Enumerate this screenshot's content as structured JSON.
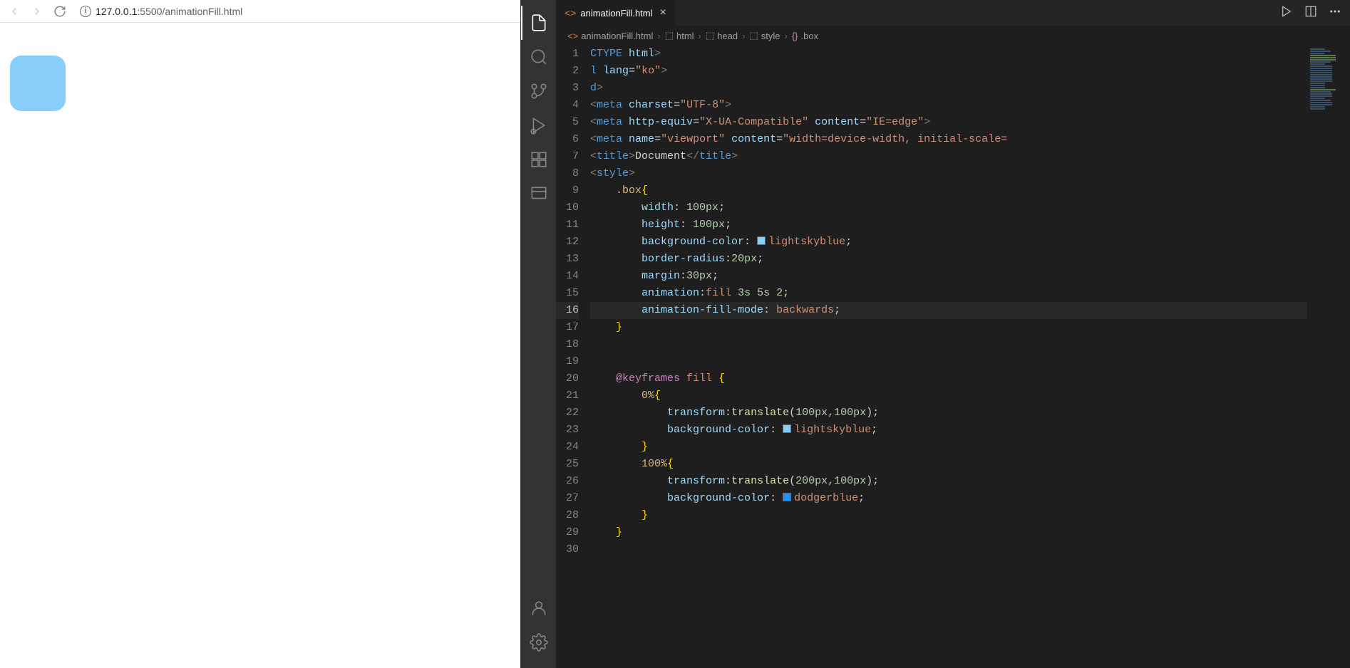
{
  "browser": {
    "url_host": "127.0.0.1",
    "url_port_path": ":5500/animationFill.html"
  },
  "tab": {
    "name": "animationFill.html",
    "close": "×"
  },
  "breadcrumbs": {
    "file": "animationFill.html",
    "html": "html",
    "head": "head",
    "style": "style",
    "box": ".box"
  },
  "sep": "›",
  "code": {
    "lines": [
      {
        "n": "1",
        "html": "<span class='tok-tag'>CTYPE</span> <span class='tok-attr'>html</span><span class='tok-punct'>&gt;</span>"
      },
      {
        "n": "2",
        "html": "<span class='tok-tag'>l</span> <span class='tok-attr'>lang</span>=<span class='tok-str'>\"ko\"</span><span class='tok-punct'>&gt;</span>"
      },
      {
        "n": "3",
        "html": "<span class='tok-tag'>d</span><span class='tok-punct'>&gt;</span>"
      },
      {
        "n": "4",
        "html": "<span class='tok-punct'>&lt;</span><span class='tok-tag'>meta</span> <span class='tok-attr'>charset</span>=<span class='tok-str'>\"UTF-8\"</span><span class='tok-punct'>&gt;</span>"
      },
      {
        "n": "5",
        "html": "<span class='tok-punct'>&lt;</span><span class='tok-tag'>meta</span> <span class='tok-attr'>http-equiv</span>=<span class='tok-str'>\"X-UA-Compatible\"</span> <span class='tok-attr'>content</span>=<span class='tok-str'>\"IE=edge\"</span><span class='tok-punct'>&gt;</span>"
      },
      {
        "n": "6",
        "html": "<span class='tok-punct'>&lt;</span><span class='tok-tag'>meta</span> <span class='tok-attr'>name</span>=<span class='tok-str'>\"viewport\"</span> <span class='tok-attr'>content</span>=<span class='tok-str'>\"width=device-width, initial-scale=</span>"
      },
      {
        "n": "7",
        "html": "<span class='tok-punct'>&lt;</span><span class='tok-tag'>title</span><span class='tok-punct'>&gt;</span><span class='tok-text'>Document</span><span class='tok-punct'>&lt;/</span><span class='tok-tag'>title</span><span class='tok-punct'>&gt;</span>"
      },
      {
        "n": "8",
        "html": "<span class='tok-punct'>&lt;</span><span class='tok-tag'>style</span><span class='tok-punct'>&gt;</span>"
      },
      {
        "n": "9",
        "html": "    <span class='tok-sel'>.box</span><span class='tok-brace'>{</span>"
      },
      {
        "n": "10",
        "html": "        <span class='tok-prop'>width</span>: <span class='tok-num'>100px</span>;"
      },
      {
        "n": "11",
        "html": "        <span class='tok-prop'>height</span>: <span class='tok-num'>100px</span>;"
      },
      {
        "n": "12",
        "html": "        <span class='tok-prop'>background-color</span>: <span class='color-swatch' style='background:lightskyblue'></span><span class='tok-val'>lightskyblue</span>;"
      },
      {
        "n": "13",
        "html": "        <span class='tok-prop'>border-radius</span>:<span class='tok-num'>20px</span>;"
      },
      {
        "n": "14",
        "html": "        <span class='tok-prop'>margin</span>:<span class='tok-num'>30px</span>;"
      },
      {
        "n": "15",
        "html": "        <span class='tok-prop'>animation</span>:<span class='tok-val'>fill</span> <span class='tok-num'>3s</span> <span class='tok-num'>5s</span> <span class='tok-num'>2</span>;"
      },
      {
        "n": "16",
        "current": true,
        "html": "        <span class='tok-prop'>animation-fill-mode</span>: <span class='tok-val'>backwards</span>;"
      },
      {
        "n": "17",
        "html": "    <span class='tok-brace'>}</span>"
      },
      {
        "n": "18",
        "html": ""
      },
      {
        "n": "19",
        "html": ""
      },
      {
        "n": "20",
        "html": "    <span class='tok-kw'>@keyframes</span> <span class='tok-val'>fill</span> <span class='tok-brace'>{</span>"
      },
      {
        "n": "21",
        "html": "        <span class='tok-sel'>0%</span><span class='tok-brace'>{</span>"
      },
      {
        "n": "22",
        "html": "            <span class='tok-prop'>transform</span>:<span class='tok-func'>translate</span>(<span class='tok-num'>100px</span>,<span class='tok-num'>100px</span>);"
      },
      {
        "n": "23",
        "html": "            <span class='tok-prop'>background-color</span>: <span class='color-swatch' style='background:lightskyblue'></span><span class='tok-val'>lightskyblue</span>;"
      },
      {
        "n": "24",
        "html": "        <span class='tok-brace'>}</span>"
      },
      {
        "n": "25",
        "html": "        <span class='tok-sel'>100%</span><span class='tok-brace'>{</span>"
      },
      {
        "n": "26",
        "html": "            <span class='tok-prop'>transform</span>:<span class='tok-func'>translate</span>(<span class='tok-num'>200px</span>,<span class='tok-num'>100px</span>);"
      },
      {
        "n": "27",
        "html": "            <span class='tok-prop'>background-color</span>: <span class='color-swatch' style='background:dodgerblue'></span><span class='tok-val'>dodgerblue</span>;"
      },
      {
        "n": "28",
        "html": "        <span class='tok-brace'>}</span>"
      },
      {
        "n": "29",
        "html": "    <span class='tok-brace'>}</span>"
      },
      {
        "n": "30",
        "html": ""
      }
    ]
  }
}
